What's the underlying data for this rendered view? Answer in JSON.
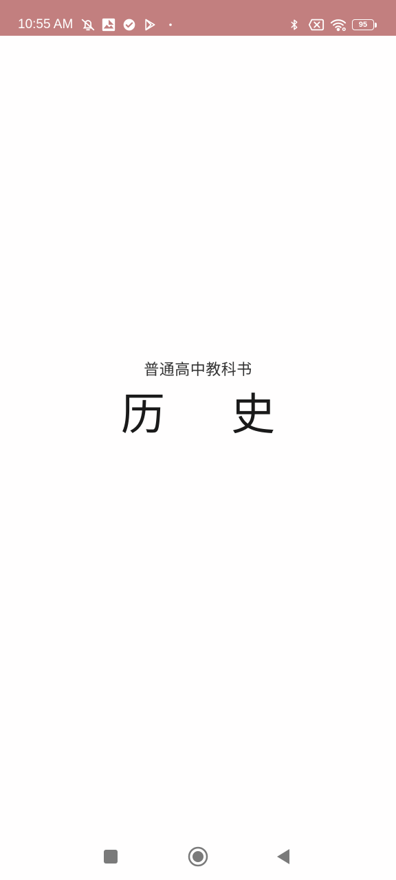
{
  "status_bar": {
    "time": "10:55 AM",
    "battery_level": "95",
    "background_color": "#c27f7f",
    "left_icons": [
      "muted-bell-icon",
      "photo-icon",
      "check-circle-icon",
      "play-store-icon",
      "dot-icon"
    ],
    "right_icons": [
      "bluetooth-icon",
      "no-sim-icon",
      "wifi-icon",
      "battery-icon"
    ]
  },
  "book": {
    "subtitle": "普通高中教科书",
    "title": "历 史"
  },
  "nav_bar": {
    "buttons": [
      "recent-apps-button",
      "home-button",
      "back-button"
    ]
  }
}
